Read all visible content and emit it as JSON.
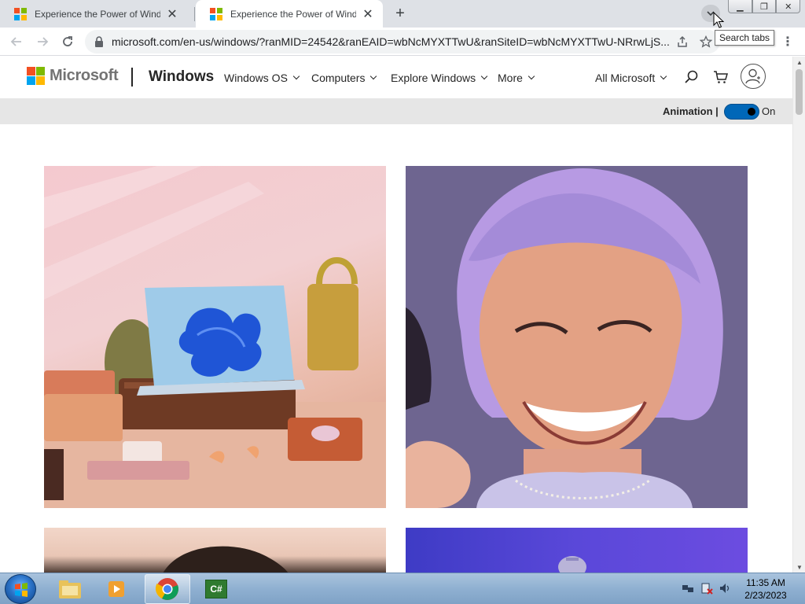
{
  "browser": {
    "tabs": [
      {
        "title": "Experience the Power of Windows 11",
        "active": false
      },
      {
        "title": "Experience the Power of Windows 11",
        "active": true
      }
    ],
    "url": "microsoft.com/en-us/windows/?ranMID=24542&ranEAID=wbNcMYXTTwU&ranSiteID=wbNcMYXTTwU-NRrwLjS...",
    "tooltip": "Search tabs"
  },
  "header": {
    "logo_text": "Microsoft",
    "brand": "Windows",
    "menu": [
      "Windows OS",
      "Computers",
      "Explore Windows",
      "More"
    ],
    "all_microsoft": "All Microsoft"
  },
  "animation": {
    "label": "Animation |",
    "state": "On"
  },
  "taskbar": {
    "time": "11:35 AM",
    "date": "2/23/2023",
    "csharp_label": "C#"
  },
  "colors": {
    "ms_red": "#f25022",
    "ms_green": "#7fba00",
    "ms_blue": "#00a4ef",
    "ms_yellow": "#ffb900",
    "toggle_accent": "#0067b8"
  },
  "icons": [
    "microsoft-logo-icon",
    "search-icon",
    "cart-icon",
    "account-icon",
    "lock-icon",
    "share-icon",
    "star-icon",
    "chrome-icon",
    "explorer-icon",
    "media-player-icon"
  ]
}
